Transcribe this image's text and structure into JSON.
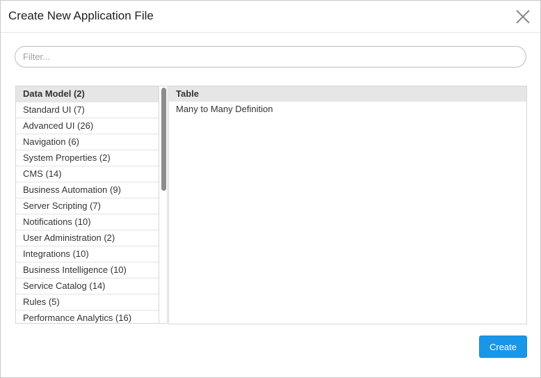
{
  "dialog": {
    "title": "Create New Application File",
    "close_icon": "close-x-icon"
  },
  "filter": {
    "placeholder": "Filter...",
    "value": ""
  },
  "categories": [
    {
      "label": "Data Model (2)",
      "selected": true
    },
    {
      "label": "Standard UI (7)"
    },
    {
      "label": "Advanced UI (26)"
    },
    {
      "label": "Navigation (6)"
    },
    {
      "label": "System Properties (2)"
    },
    {
      "label": "CMS (14)"
    },
    {
      "label": "Business Automation (9)"
    },
    {
      "label": "Server Scripting (7)"
    },
    {
      "label": "Notifications (10)"
    },
    {
      "label": "User Administration (2)"
    },
    {
      "label": "Integrations (10)"
    },
    {
      "label": "Business Intelligence (10)"
    },
    {
      "label": "Service Catalog (14)"
    },
    {
      "label": "Rules (5)"
    },
    {
      "label": "Performance Analytics (16)"
    }
  ],
  "file_types": {
    "header": "Table",
    "items": [
      "Many to Many Definition"
    ]
  },
  "footer": {
    "create_label": "Create"
  },
  "colors": {
    "primary_button": "#1a96e8",
    "selected_row": "#e6e6e6"
  }
}
